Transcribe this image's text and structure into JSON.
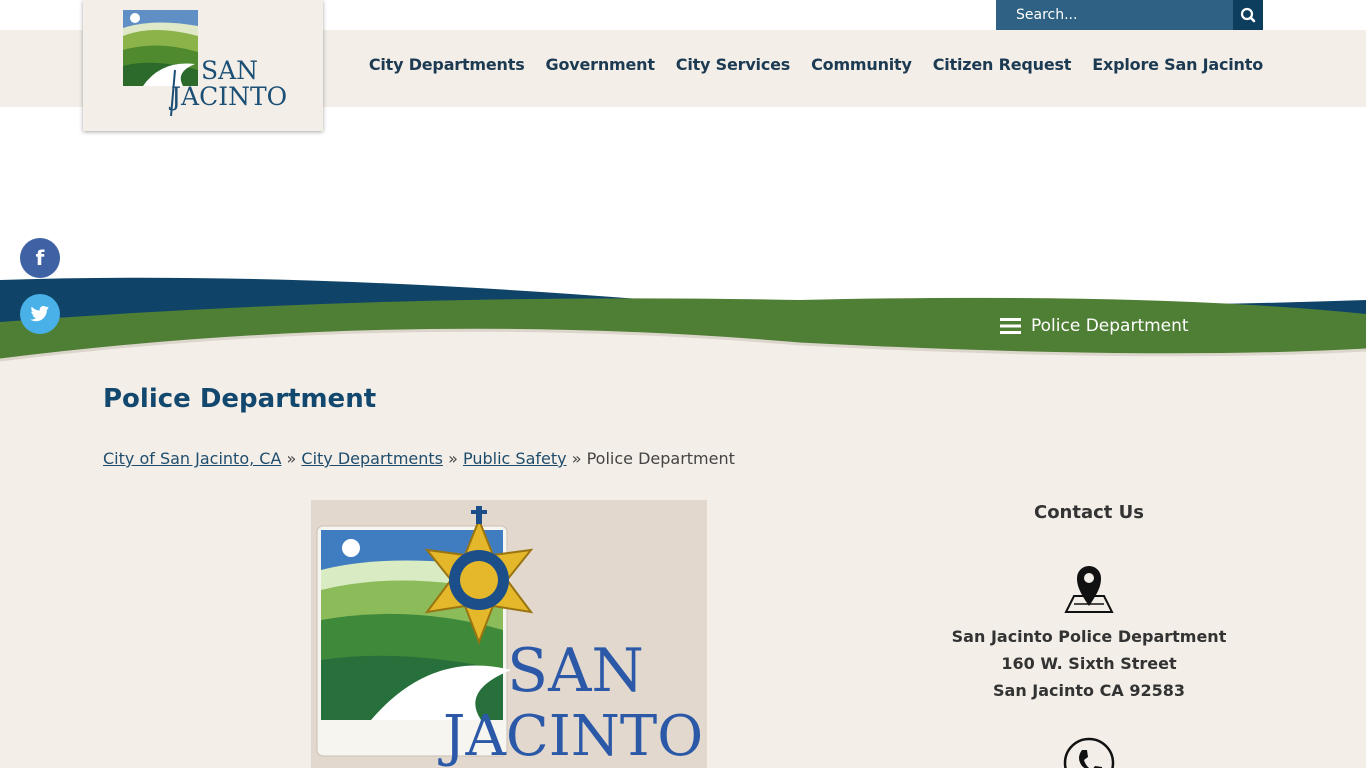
{
  "header": {
    "search_placeholder": "Search...",
    "logo_text_line1": "SAN",
    "logo_text_line2": "JACINTO"
  },
  "nav": {
    "items": [
      "City Departments",
      "Government",
      "City Services",
      "Community",
      "Citizen Request",
      "Explore San Jacinto"
    ]
  },
  "section_menu": {
    "label": "Police Department"
  },
  "social": {
    "facebook": "f",
    "twitter": "t"
  },
  "content": {
    "title": "Police Department",
    "breadcrumb": [
      "City of San Jacinto, CA",
      "City Departments",
      "Public Safety",
      "Police Department"
    ],
    "breadcrumb_separator": "»",
    "hero_text_line1": "SAN",
    "hero_text_line2": "JACINTO"
  },
  "contact": {
    "title": "Contact Us",
    "name": "San Jacinto Police Department",
    "street": "160 W. Sixth Street",
    "city": "San Jacinto CA 92583"
  },
  "colors": {
    "brand_blue": "#12476e",
    "brand_green": "#4f7e35",
    "search_bg": "#2e6183",
    "background": "#f3eee8"
  }
}
